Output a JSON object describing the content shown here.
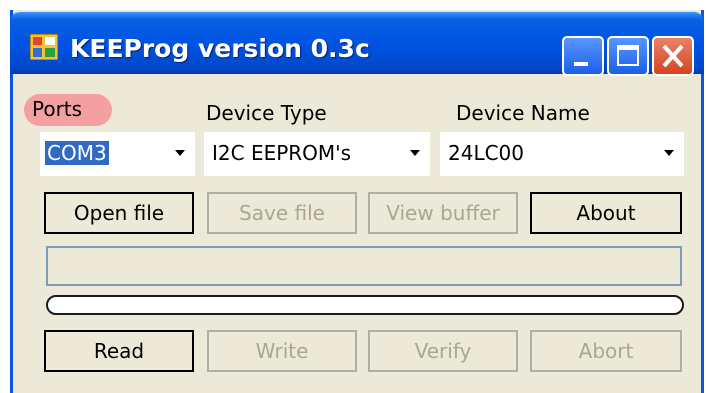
{
  "window": {
    "title": "KEEProg version 0.3c"
  },
  "labels": {
    "ports": "Ports",
    "device_type": "Device Type",
    "device_name": "Device Name"
  },
  "combos": {
    "port": "COM3",
    "device_type": "I2C EEPROM's",
    "device_name": "24LC00"
  },
  "buttons": {
    "open_file": "Open file",
    "save_file": "Save file",
    "view_buffer": "View buffer",
    "about": "About",
    "read": "Read",
    "write": "Write",
    "verify": "Verify",
    "abort": "Abort"
  },
  "status": {
    "text": ""
  },
  "progress": {
    "value": 0
  },
  "colors": {
    "titlebar": "#0054e3",
    "highlight": "#f5a0a0",
    "selection": "#316ac5",
    "dialog_bg": "#ece9d8"
  }
}
